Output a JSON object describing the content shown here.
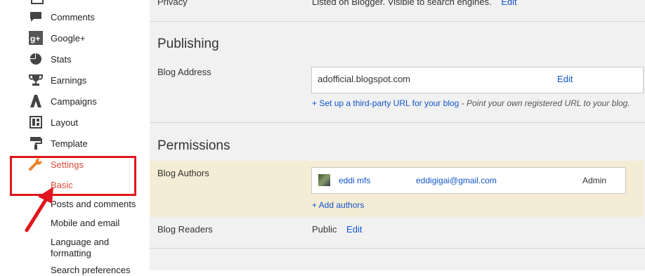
{
  "sidebar": {
    "items": [
      {
        "label": "Comments",
        "icon": "comment-icon"
      },
      {
        "label": "Google+",
        "icon": "google-plus-icon"
      },
      {
        "label": "Stats",
        "icon": "pie-chart-icon"
      },
      {
        "label": "Earnings",
        "icon": "trophy-icon"
      },
      {
        "label": "Campaigns",
        "icon": "campaigns-icon"
      },
      {
        "label": "Layout",
        "icon": "layout-icon"
      },
      {
        "label": "Template",
        "icon": "paint-roller-icon"
      },
      {
        "label": "Settings",
        "icon": "wrench-icon"
      }
    ],
    "subitems": [
      {
        "label": "Basic"
      },
      {
        "label": "Posts and comments"
      },
      {
        "label": "Mobile and email"
      },
      {
        "label": "Language and formatting"
      },
      {
        "label": "Search preferences"
      }
    ]
  },
  "main": {
    "privacy": {
      "label": "Privacy",
      "value": "Listed on Blogger. Visible to search engines.",
      "edit": "Edit"
    },
    "publishing": {
      "title": "Publishing",
      "blog_address_label": "Blog Address",
      "address": "adofficial.blogspot.com",
      "edit": "Edit",
      "third_party_link": "+ Set up a third-party URL for your blog",
      "third_party_note": " - Point your own registered URL to your blog."
    },
    "permissions": {
      "title": "Permissions",
      "authors_label": "Blog Authors",
      "author_name": "eddi mfs",
      "author_email": "eddigigai@gmail.com",
      "author_role": "Admin",
      "add_authors": "+ Add authors",
      "readers_label": "Blog Readers",
      "readers_value": "Public",
      "readers_edit": "Edit"
    }
  },
  "colors": {
    "active": "#dd4b39",
    "link": "#1155cc",
    "annotation": "#e0161c",
    "highlight": "#f4ecd4"
  }
}
